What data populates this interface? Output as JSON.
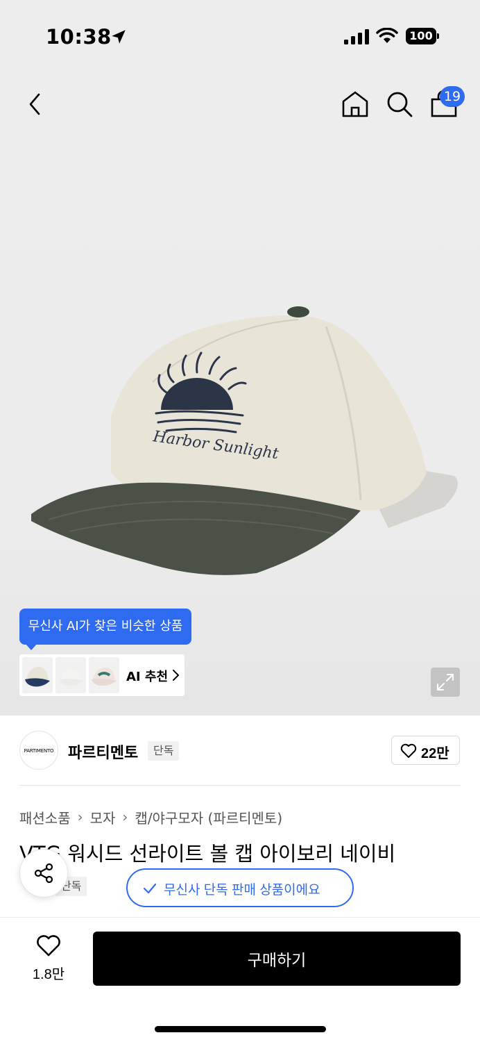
{
  "status_bar": {
    "time": "10:38",
    "battery": "100"
  },
  "header": {
    "cart_count": "19"
  },
  "ai": {
    "tooltip": "무신사 AI가 찾은 비슷한 상품",
    "rec_label": "AI 추천"
  },
  "brand": {
    "logo_text": "PARTIMENTO",
    "name": "파르티멘토",
    "tag": "단독",
    "likes": "22만"
  },
  "breadcrumb": [
    "패션소품",
    "모자",
    "캡/야구모자 (파르티멘토)"
  ],
  "product": {
    "title": "VTG 워시드 선라이트 볼 캡 아이보리 네이비",
    "sub_tag": "단독",
    "exclusive_badge": "무신사 단독 판매 상품이에요"
  },
  "bottom_bar": {
    "wish_count": "1.8만",
    "buy_label": "구매하기"
  },
  "colors": {
    "accent": "#2f6bf0",
    "primary_button": "#000000"
  }
}
